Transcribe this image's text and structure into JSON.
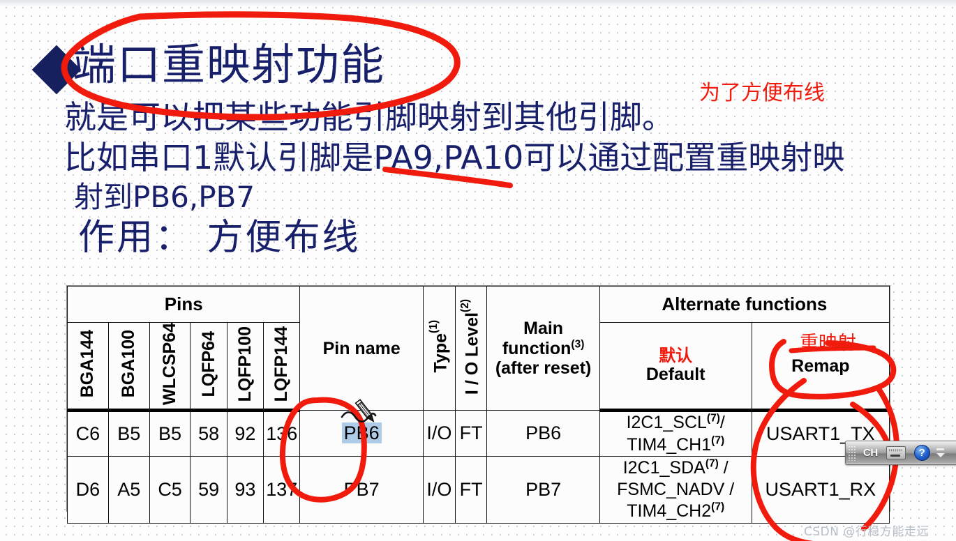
{
  "slide": {
    "title": "端口重映射功能",
    "line2": "就是可以把某些功能引脚映射到其他引脚。",
    "line3": "比如串口1默认引脚是PA9,PA10可以通过配置重映射映",
    "line4": "射到PB6,PB7",
    "line5": "作用： 方便布线",
    "note_red": "为了方便布线"
  },
  "table": {
    "group_headers": {
      "pins": "Pins",
      "alternate_functions": "Alternate functions"
    },
    "columns": [
      "BGA144",
      "BGA100",
      "WLCSP64",
      "LQFP64",
      "LQFP100",
      "LQFP144"
    ],
    "pin_name_header": "Pin name",
    "type_header": "Type",
    "type_header_sup": "(1)",
    "io_level_header": "I / O Level",
    "io_level_sup": "(2)",
    "main_function_header_1": "Main",
    "main_function_header_2": "function",
    "main_function_sup": "(3)",
    "main_function_header_3": "(after reset)",
    "default_header_cn": "默认",
    "default_header": "Default",
    "remap_header_cn": "重映射",
    "remap_header": "Remap",
    "rows": [
      {
        "bga144": "C6",
        "bga100": "B5",
        "wlcsp64": "B5",
        "lqfp64": "58",
        "lqfp100": "92",
        "lqfp144": "136",
        "pin_name": "PB6",
        "type": "I/O",
        "io_level": "FT",
        "main_function": "PB6",
        "default_af": "I2C1_SCL(7)/ TIM4_CH1(7)",
        "default_af_parts": [
          {
            "t": "I2C1_SCL",
            "sup": "(7)"
          },
          {
            "t": "/ TIM4_CH1",
            "sup": "(7)"
          }
        ],
        "remap_af": "USART1_TX"
      },
      {
        "bga144": "D6",
        "bga100": "A5",
        "wlcsp64": "C5",
        "lqfp64": "59",
        "lqfp100": "93",
        "lqfp144": "137",
        "pin_name": "PB7",
        "type": "I/O",
        "io_level": "FT",
        "main_function": "PB7",
        "default_af_line1": "I2C1_SDA",
        "default_af_line1_sup": "(7)",
        "default_af_line1_tail": " /",
        "default_af_line2": "FSMC_NADV /",
        "default_af_line3": "TIM4_CH2",
        "default_af_line3_sup": "(7)",
        "remap_af": "USART1_RX"
      }
    ]
  },
  "ime": {
    "language": "CH",
    "help_glyph": "?"
  },
  "watermark": "CSDN @行稳方能走远",
  "colors": {
    "ink_red": "#f01b0d",
    "slide_navy": "#19206b",
    "selection_blue": "#aecbe8"
  }
}
